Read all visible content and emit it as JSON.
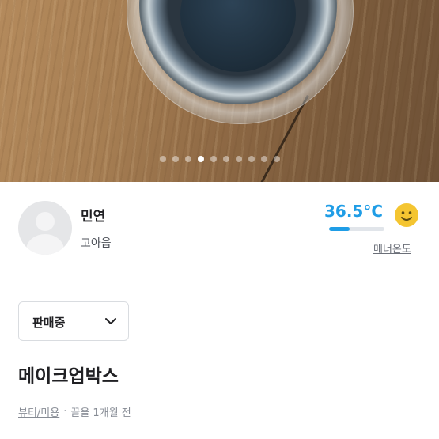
{
  "carousel": {
    "total": 10,
    "active_index": 3
  },
  "seller": {
    "name": "민연",
    "region": "고아읍",
    "temperature": "36.5°C",
    "temperature_level": 0.365,
    "manner_label": "매너온도"
  },
  "status_select": {
    "selected": "판매중"
  },
  "product": {
    "title": "메이크업박스",
    "category": "뷰티/미용",
    "separator": "·",
    "time": "끌올 1개월 전"
  },
  "colors": {
    "accent": "#1f9de6",
    "text": "#212124",
    "muted": "#868b94",
    "smiley": "#f4c531"
  },
  "icons": {
    "avatar": "default-avatar-icon",
    "temperature_face": "smiley-face-icon",
    "dropdown": "chevron-down-icon"
  }
}
